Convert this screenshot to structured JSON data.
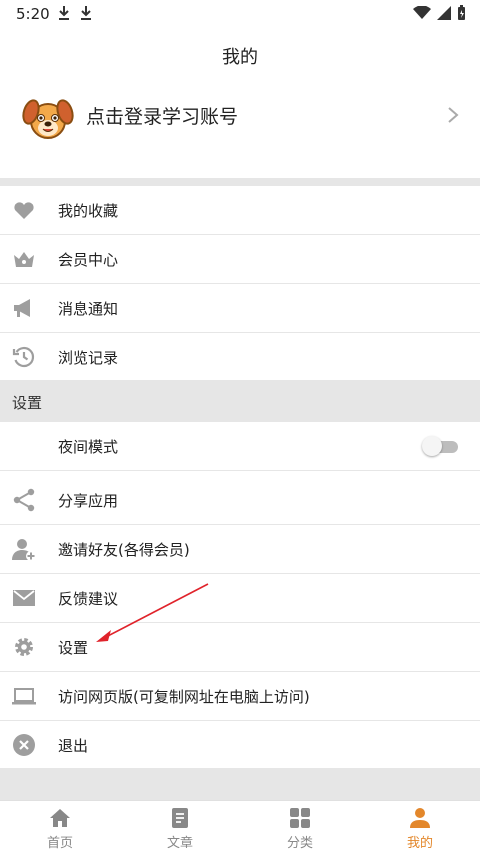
{
  "status_bar": {
    "time": "5:20"
  },
  "header": {
    "title": "我的"
  },
  "profile": {
    "login_text": "点击登录学习账号"
  },
  "menu": {
    "favorites": "我的收藏",
    "vip": "会员中心",
    "notifications": "消息通知",
    "history": "浏览记录"
  },
  "settings_section": {
    "header": "设置",
    "night_mode": "夜间模式",
    "night_mode_on": false,
    "share": "分享应用",
    "invite": "邀请好友(各得会员)",
    "feedback": "反馈建议",
    "settings": "设置",
    "web_version": "访问网页版(可复制网址在电脑上访问)",
    "logout": "退出"
  },
  "tabs": [
    {
      "label": "首页",
      "active": false
    },
    {
      "label": "文章",
      "active": false
    },
    {
      "label": "分类",
      "active": false
    },
    {
      "label": "我的",
      "active": true
    }
  ],
  "colors": {
    "accent": "#e3872b",
    "icon_grey": "#9e9e9e",
    "divider": "#e6e6e6",
    "annotation_arrow": "#e0232b"
  }
}
